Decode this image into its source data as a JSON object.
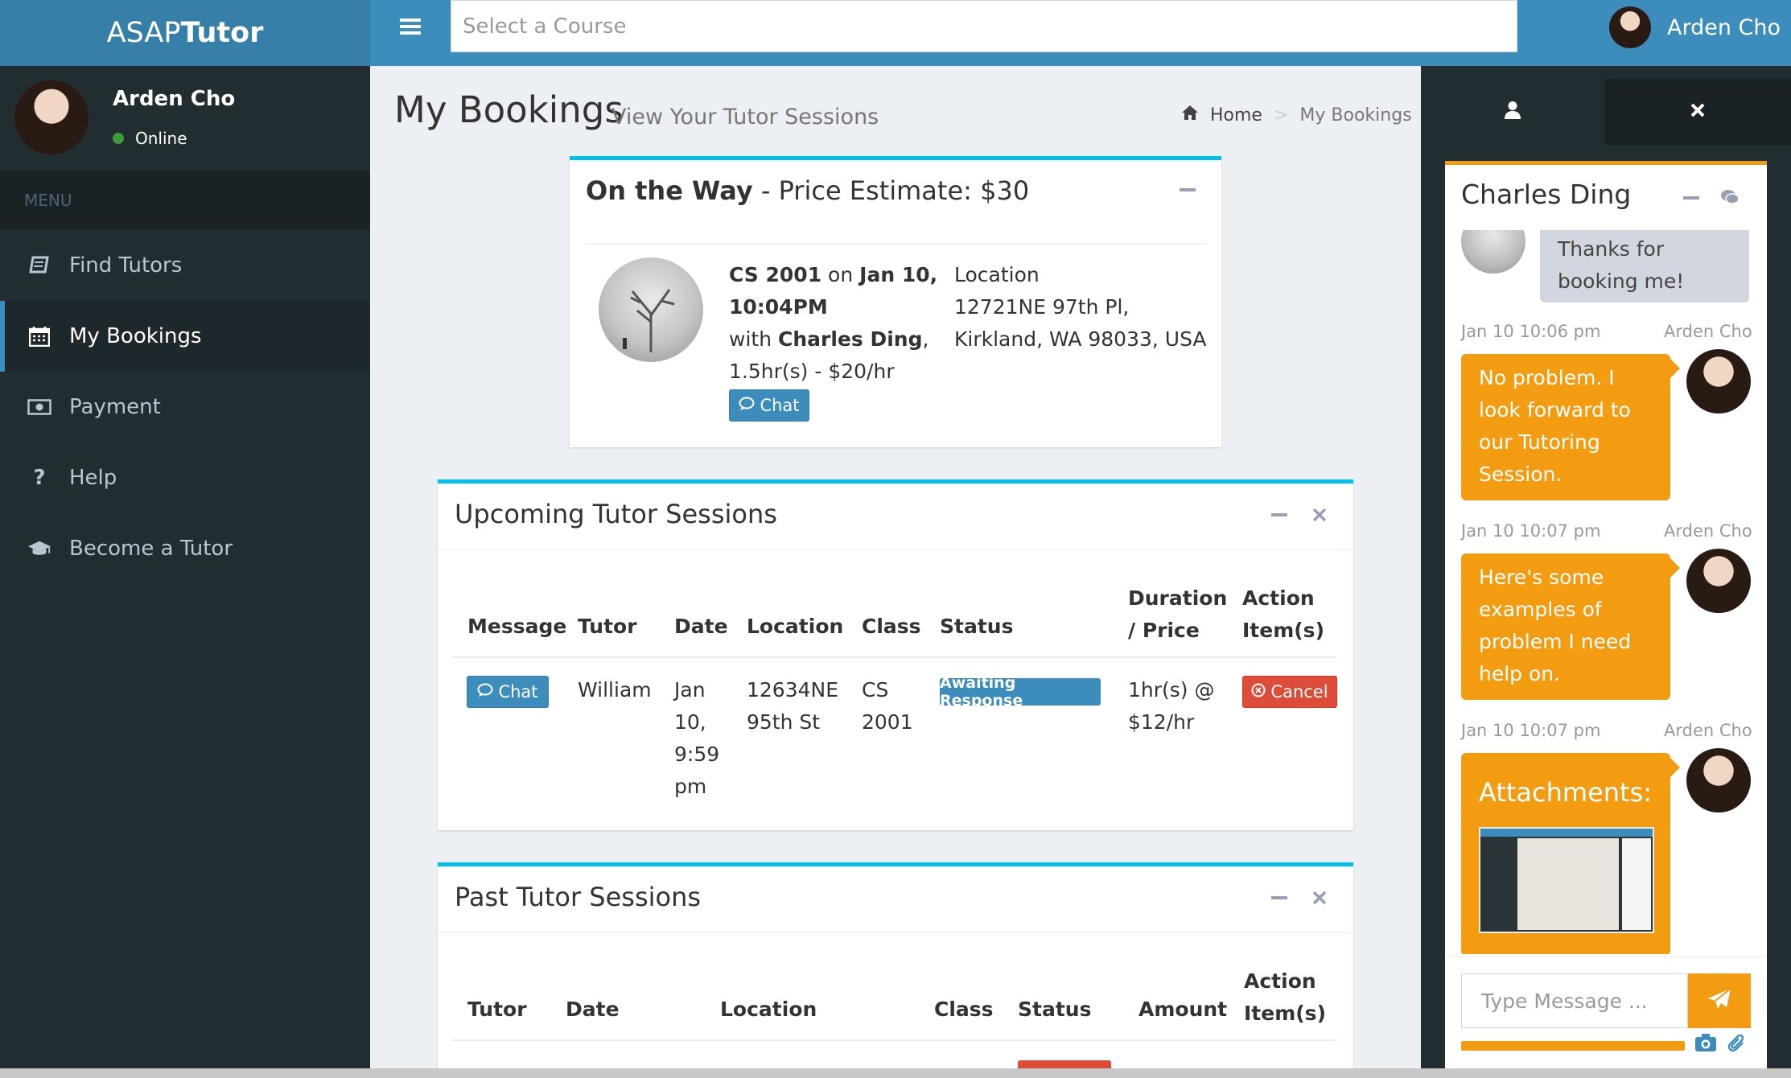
{
  "header": {
    "logo_light": "ASAP",
    "logo_bold": "Tutor",
    "course_placeholder": "Select a Course",
    "user_name": "Arden Cho",
    "menu_icon": "hamburger-icon"
  },
  "sidebar": {
    "user_name": "Arden Cho",
    "user_status": "Online",
    "menu_header": "MENU",
    "items": [
      {
        "label": "Find Tutors",
        "icon": "book-icon"
      },
      {
        "label": "My Bookings",
        "icon": "calendar-icon"
      },
      {
        "label": "Payment",
        "icon": "money-icon"
      },
      {
        "label": "Help",
        "icon": "question-icon"
      },
      {
        "label": "Become a Tutor",
        "icon": "graduation-cap-icon"
      }
    ]
  },
  "page": {
    "title": "My Bookings",
    "subtitle": "View Your Tutor Sessions",
    "breadcrumb": {
      "home": "Home",
      "separator": ">",
      "current": "My Bookings"
    }
  },
  "on_the_way": {
    "title_bold": "On the Way",
    "title_rest": " - Price Estimate: $30",
    "course": "CS 2001",
    "on": " on ",
    "date_line1": "Jan 10,",
    "date_line2": "10:04PM",
    "with": "with ",
    "tutor": "Charles Ding",
    "comma": ",",
    "duration": "1.5hr(s) - $20/hr",
    "chat_label": "Chat",
    "location_label": "Location",
    "location_line1": "12721NE 97th Pl,",
    "location_line2": "Kirkland, WA 98033, USA"
  },
  "upcoming": {
    "title": "Upcoming Tutor Sessions",
    "headers": {
      "message": "Message",
      "tutor": "Tutor",
      "date": "Date",
      "location": "Location",
      "class": "Class",
      "status": "Status",
      "duration_1": "Duration",
      "duration_2": "/ Price",
      "action_1": "Action",
      "action_2": "Item(s)"
    },
    "row": {
      "chat": "Chat",
      "tutor": "William",
      "date_1": "Jan",
      "date_2": "10,",
      "date_3": "9:59",
      "date_4": "pm",
      "location_1": "12634NE",
      "location_2": "95th St",
      "class_1": "CS",
      "class_2": "2001",
      "status": "Awaiting Response",
      "price_1": "1hr(s) @",
      "price_2": "$12/hr",
      "action": "Cancel"
    }
  },
  "past": {
    "title": "Past Tutor Sessions",
    "headers": {
      "tutor": "Tutor",
      "date": "Date",
      "location": "Location",
      "class": "Class",
      "status": "Status",
      "amount": "Amount",
      "action_1": "Action",
      "action_2": "Item(s)"
    }
  },
  "chat": {
    "title": "Charles Ding",
    "messages": [
      {
        "from": "Charles Ding",
        "text_1": "Thanks for",
        "text_2": "booking me!"
      },
      {
        "time": "Jan 10 10:06 pm",
        "name": "Arden Cho",
        "lines": [
          "No problem. I",
          "look forward to",
          "our Tutoring",
          "Session."
        ]
      },
      {
        "time": "Jan 10 10:07 pm",
        "name": "Arden Cho",
        "lines": [
          "Here's some",
          "examples of",
          "problem I need",
          "help on."
        ]
      },
      {
        "time": "Jan 10 10:07 pm",
        "name": "Arden Cho",
        "attachments_label": "Attachments:"
      }
    ],
    "input_placeholder": "Type Message ..."
  },
  "colors": {
    "primary": "#3c8dbc",
    "sidebar_bg": "#222d32",
    "box_border": "#00c0ef",
    "chat_accent": "#f39c12",
    "danger": "#dd4b39"
  }
}
